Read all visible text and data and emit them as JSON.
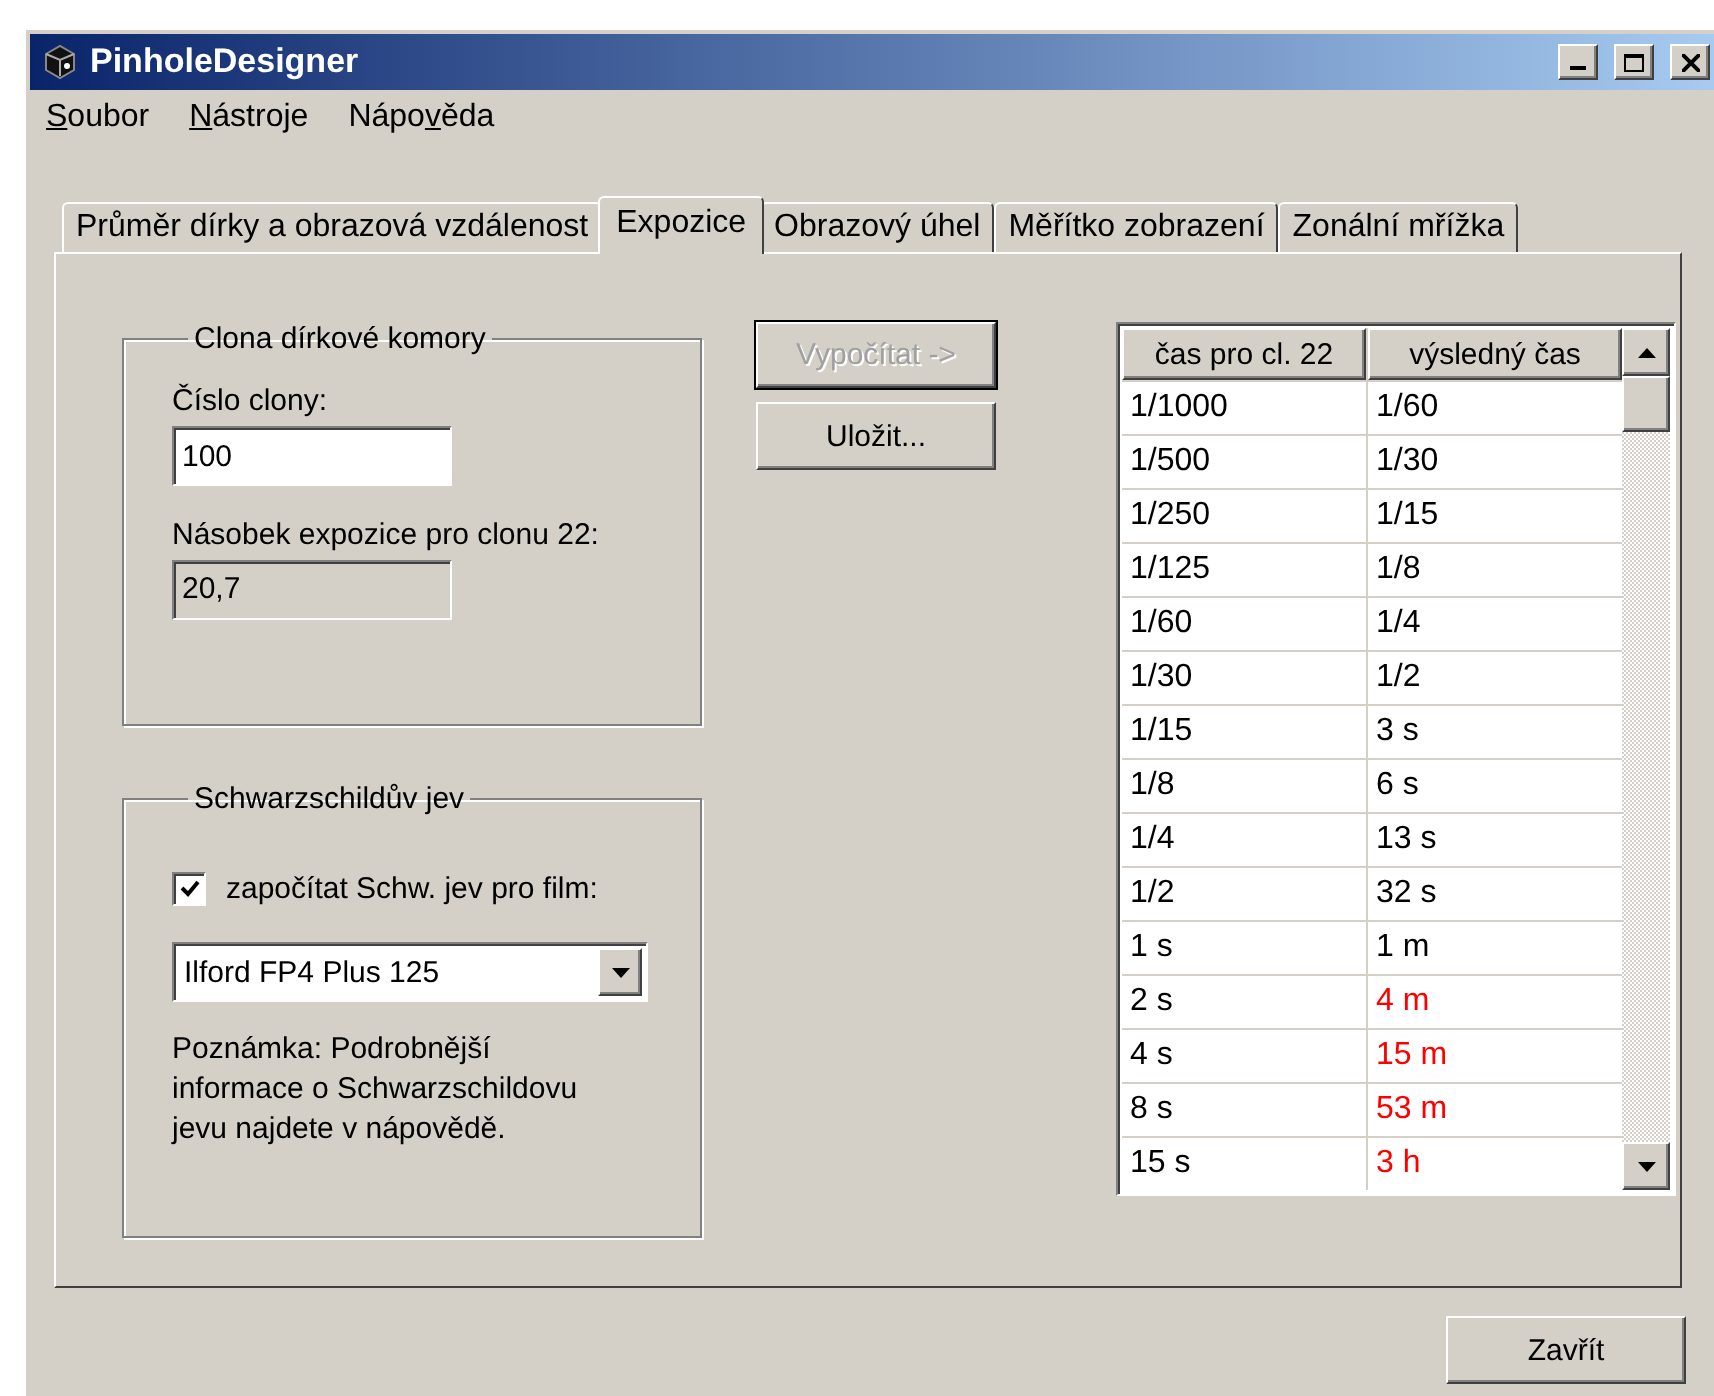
{
  "window": {
    "title": "PinholeDesigner"
  },
  "menu": [
    {
      "mnemonic": "S",
      "after": "oubor"
    },
    {
      "mnemonic": "N",
      "after": "ástroje"
    },
    {
      "before": "Nápo",
      "mnemonic": "v",
      "after": "ěda"
    }
  ],
  "tabs": [
    {
      "label": "Průměr dírky a obrazová vzdálenost",
      "selected": false
    },
    {
      "label": "Expozice",
      "selected": true
    },
    {
      "label": "Obrazový úhel",
      "selected": false
    },
    {
      "label": "Měřítko zobrazení",
      "selected": false
    },
    {
      "label": "Zonální mřížka",
      "selected": false
    }
  ],
  "aperture_group": {
    "title": "Clona dírkové komory",
    "number_label": "Číslo clony:",
    "number_value": "100",
    "multiplier_label": "Násobek expozice pro clonu 22:",
    "multiplier_value": "20,7"
  },
  "schwarzschild_group": {
    "title": "Schwarzschildův jev",
    "checkbox": {
      "label": "započítat Schw. jev pro film:",
      "checked": true
    },
    "film": "Ilford FP4 Plus 125",
    "note": "Poznámka: Podrobnější informace o Schwarzschildovu jevu najdete v nápovědě."
  },
  "buttons": [
    {
      "label": "Vypočítat ->",
      "disabled": true
    },
    {
      "label": "Uložit...",
      "disabled": false
    }
  ],
  "table": {
    "columns": [
      "čas pro cl. 22",
      "výsledný čas"
    ],
    "rows": [
      {
        "base": "1/1000",
        "result": "1/60",
        "warning": false
      },
      {
        "base": "1/500",
        "result": "1/30",
        "warning": false
      },
      {
        "base": "1/250",
        "result": "1/15",
        "warning": false
      },
      {
        "base": "1/125",
        "result": "1/8",
        "warning": false
      },
      {
        "base": "1/60",
        "result": "1/4",
        "warning": false
      },
      {
        "base": "1/30",
        "result": "1/2",
        "warning": false
      },
      {
        "base": "1/15",
        "result": "3 s",
        "warning": false
      },
      {
        "base": "1/8",
        "result": "6 s",
        "warning": false
      },
      {
        "base": "1/4",
        "result": "13 s",
        "warning": false
      },
      {
        "base": "1/2",
        "result": "32 s",
        "warning": false
      },
      {
        "base": "1 s",
        "result": "1 m",
        "warning": false
      },
      {
        "base": "2 s",
        "result": "4 m",
        "warning": true
      },
      {
        "base": "4 s",
        "result": "15 m",
        "warning": true
      },
      {
        "base": "8 s",
        "result": "53 m",
        "warning": true
      },
      {
        "base": "15 s",
        "result": "3 h",
        "warning": true
      }
    ]
  },
  "close_button": "Zavřít"
}
